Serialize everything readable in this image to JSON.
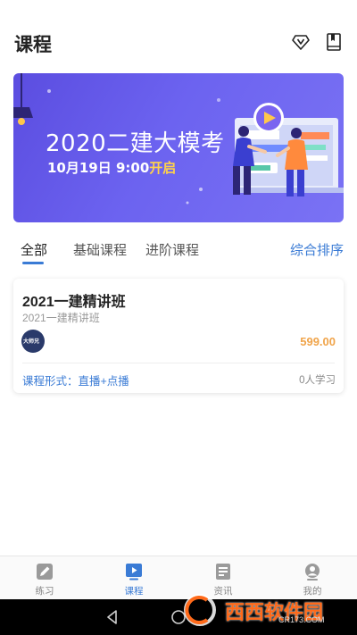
{
  "header": {
    "title": "课程",
    "vip_icon": "vip-diamond-icon",
    "book_icon": "bookmark-book-icon"
  },
  "banner": {
    "title": "2020二建大模考",
    "date_prefix": "10月19日 9:00",
    "date_suffix": "开启",
    "bg_color": "#6457e8",
    "accent_color": "#ffd24a"
  },
  "tabs": {
    "items": [
      {
        "label": "全部",
        "active": true
      },
      {
        "label": "基础课程",
        "active": false
      },
      {
        "label": "进阶课程",
        "active": false
      }
    ],
    "sort_label": "综合排序",
    "accent_color": "#3a7bd5"
  },
  "course_card": {
    "title": "2021一建精讲班",
    "subtitle": "2021一建精讲班",
    "logo_text": "大师兄",
    "price": "599.00",
    "format": "课程形式：直播+点播",
    "learners": "0人学习"
  },
  "bottom_nav": {
    "items": [
      {
        "label": "练习",
        "icon": "pencil-icon",
        "active": false
      },
      {
        "label": "课程",
        "icon": "play-icon",
        "active": true
      },
      {
        "label": "资讯",
        "icon": "news-icon",
        "active": false
      },
      {
        "label": "我的",
        "icon": "profile-icon",
        "active": false
      }
    ]
  },
  "watermark": {
    "brand": "西西软件园",
    "url": "CR173.COM"
  }
}
